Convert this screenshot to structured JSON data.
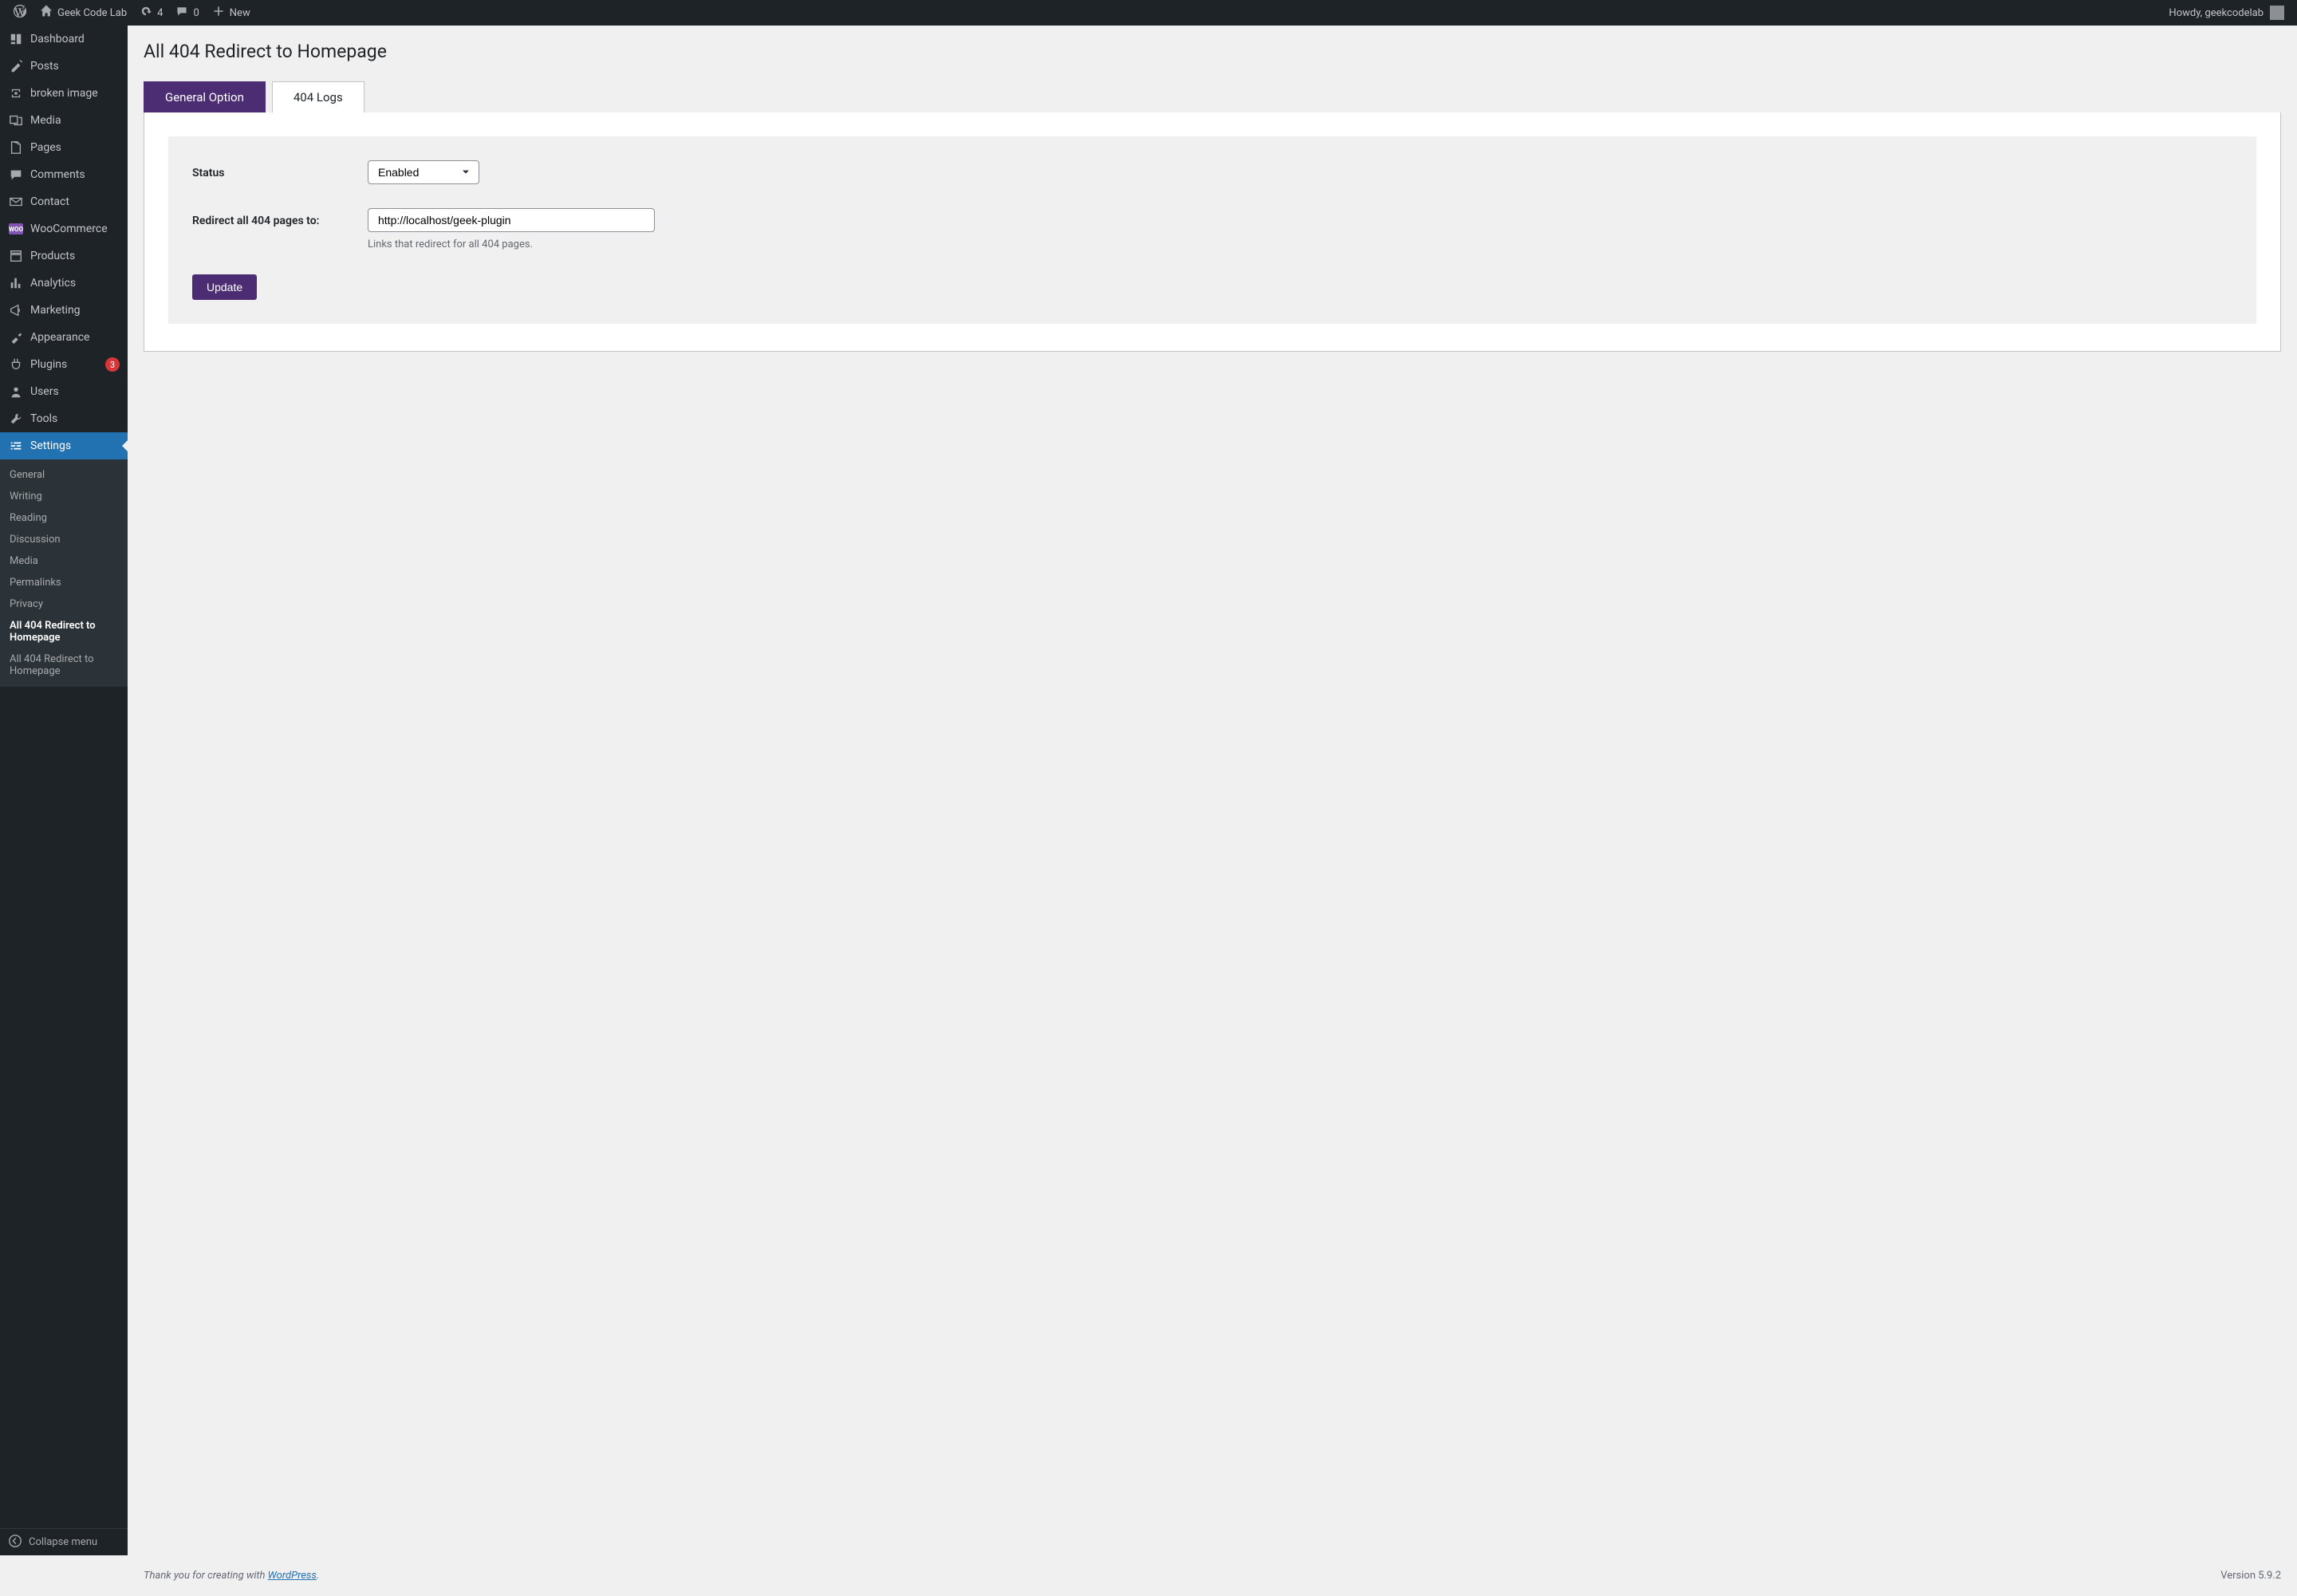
{
  "adminbar": {
    "site_name": "Geek Code Lab",
    "updates_count": "4",
    "comments_count": "0",
    "new_label": "New",
    "howdy_prefix": "Howdy, ",
    "user_name": "geekcodelab"
  },
  "sidebar": {
    "items": [
      {
        "id": "dashboard",
        "label": "Dashboard"
      },
      {
        "id": "posts",
        "label": "Posts"
      },
      {
        "id": "brokenimage",
        "label": "broken image"
      },
      {
        "id": "media",
        "label": "Media"
      },
      {
        "id": "pages",
        "label": "Pages"
      },
      {
        "id": "comments",
        "label": "Comments"
      },
      {
        "id": "contact",
        "label": "Contact"
      },
      {
        "id": "woocommerce",
        "label": "WooCommerce"
      },
      {
        "id": "products",
        "label": "Products"
      },
      {
        "id": "analytics",
        "label": "Analytics"
      },
      {
        "id": "marketing",
        "label": "Marketing"
      },
      {
        "id": "appearance",
        "label": "Appearance"
      },
      {
        "id": "plugins",
        "label": "Plugins",
        "badge": "3"
      },
      {
        "id": "users",
        "label": "Users"
      },
      {
        "id": "tools",
        "label": "Tools"
      },
      {
        "id": "settings",
        "label": "Settings",
        "current": true
      }
    ],
    "submenu": [
      {
        "label": "General"
      },
      {
        "label": "Writing"
      },
      {
        "label": "Reading"
      },
      {
        "label": "Discussion"
      },
      {
        "label": "Media"
      },
      {
        "label": "Permalinks"
      },
      {
        "label": "Privacy"
      },
      {
        "label": "All 404 Redirect to Homepage",
        "current": true
      },
      {
        "label": "All 404 Redirect to Homepage"
      }
    ],
    "collapse_label": "Collapse menu"
  },
  "page": {
    "title": "All 404 Redirect to Homepage",
    "tabs": [
      {
        "label": "General Option",
        "active": true
      },
      {
        "label": "404 Logs"
      }
    ],
    "form": {
      "status_label": "Status",
      "status_value": "Enabled",
      "redirect_label": "Redirect all 404 pages to:",
      "redirect_value": "http://localhost/geek-plugin",
      "redirect_help": "Links that redirect for all 404 pages.",
      "submit_label": "Update"
    }
  },
  "footer": {
    "thanks_prefix": "Thank you for creating with ",
    "wp_link_label": "WordPress",
    "thanks_suffix": ".",
    "version": "Version 5.9.2"
  }
}
